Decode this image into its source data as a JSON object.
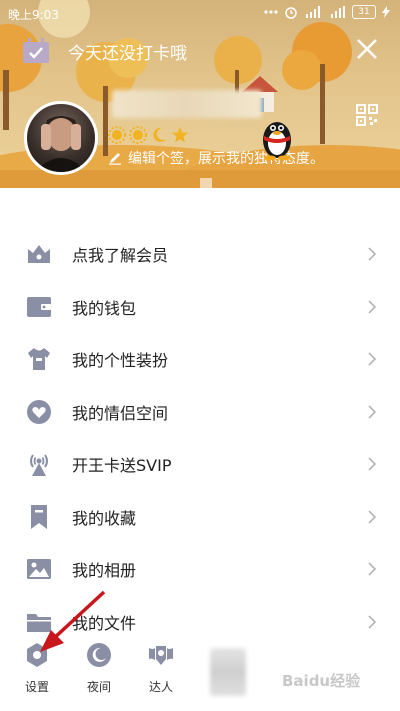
{
  "status_bar": {
    "time": "晚上9:03",
    "battery": "31"
  },
  "header": {
    "checkin_text": "今天还没打卡哦",
    "signature": "编辑个签，展示我的独特态度。"
  },
  "menu": {
    "items": [
      {
        "label": "点我了解会员",
        "icon": "crown-icon"
      },
      {
        "label": "我的钱包",
        "icon": "wallet-icon"
      },
      {
        "label": "我的个性装扮",
        "icon": "tshirt-icon"
      },
      {
        "label": "我的情侣空间",
        "icon": "couple-heart-icon"
      },
      {
        "label": "开王卡送SVIP",
        "icon": "signal-tower-icon"
      },
      {
        "label": "我的收藏",
        "icon": "bookmark-icon"
      },
      {
        "label": "我的相册",
        "icon": "photo-album-icon"
      },
      {
        "label": "我的文件",
        "icon": "folder-icon"
      }
    ]
  },
  "bottom_bar": {
    "settings": "设置",
    "night": "夜间",
    "expert": "达人"
  },
  "watermark": "Baidu经验",
  "colors": {
    "icon_gray": "#8a8fa6",
    "arrow_red": "#c8161d",
    "banner_sky": "#e3c58c"
  }
}
